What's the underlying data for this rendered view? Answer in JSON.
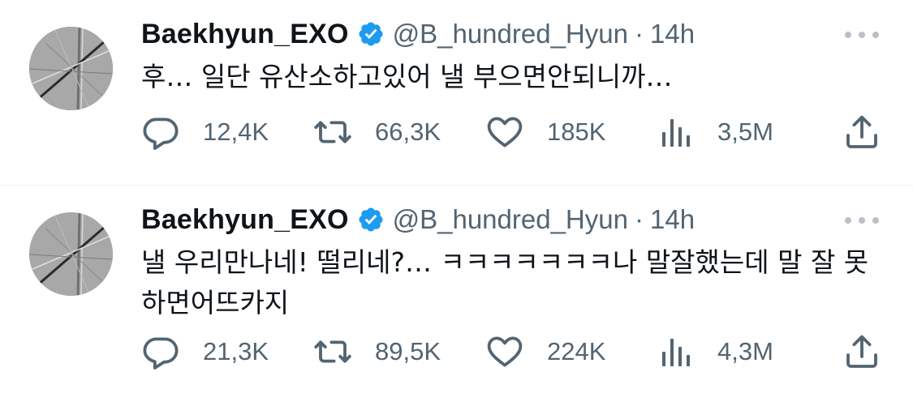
{
  "tweets": [
    {
      "name": "Baekhyun_EXO",
      "handle": "@B_hundred_Hyun",
      "separator": "·",
      "time": "14h",
      "text": "후… 일단 유산소하고있어 낼 부으면안되니까…",
      "replies": "12,4K",
      "retweets": "66,3K",
      "likes": "185K",
      "views": "3,5M"
    },
    {
      "name": "Baekhyun_EXO",
      "handle": "@B_hundred_Hyun",
      "separator": "·",
      "time": "14h",
      "text": "낼 우리만나네! 떨리네?… ㅋㅋㅋㅋㅋㅋㅋ나 말잘했는데 말 잘 못하면어뜨카지",
      "replies": "21,3K",
      "retweets": "89,5K",
      "likes": "224K",
      "views": "4,3M"
    }
  ],
  "icons": {
    "verified": "verified-badge-icon",
    "more": "more-horizontal-icon",
    "reply": "reply-bubble-icon",
    "retweet": "retweet-icon",
    "like": "heart-icon",
    "views": "views-bar-chart-icon",
    "share": "share-upload-icon"
  },
  "colors": {
    "text": "#0f1419",
    "secondary": "#536471",
    "verified": "#1d9bf0",
    "divider": "#eff3f4"
  }
}
